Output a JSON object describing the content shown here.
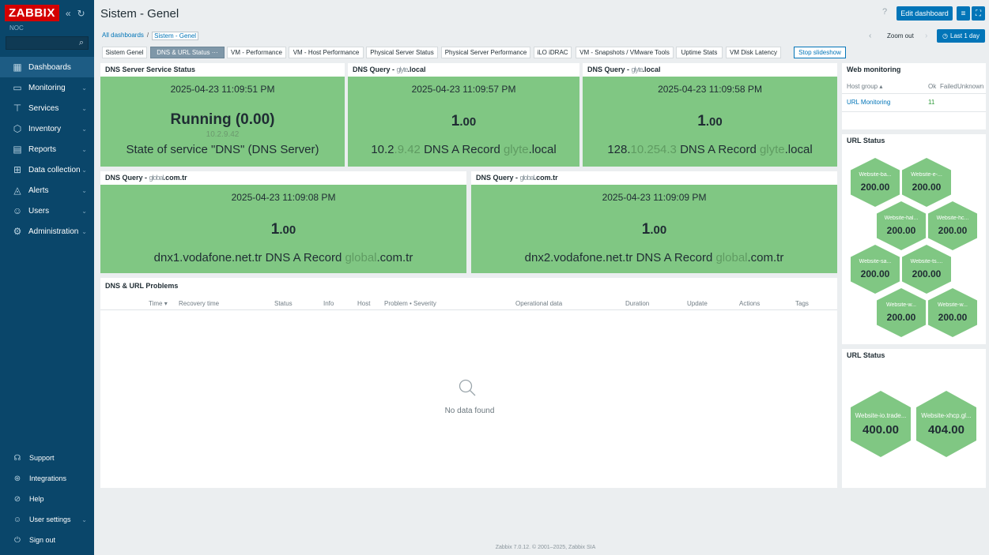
{
  "sidebar": {
    "logo": "ZABBIX",
    "server_name": "NOC",
    "items": [
      {
        "label": "Dashboards",
        "icon": "dashboards-icon"
      },
      {
        "label": "Monitoring",
        "icon": "monitoring-icon"
      },
      {
        "label": "Services",
        "icon": "services-icon"
      },
      {
        "label": "Inventory",
        "icon": "inventory-icon"
      },
      {
        "label": "Reports",
        "icon": "reports-icon"
      },
      {
        "label": "Data collection",
        "icon": "data-collection-icon"
      },
      {
        "label": "Alerts",
        "icon": "alerts-icon"
      },
      {
        "label": "Users",
        "icon": "users-icon"
      },
      {
        "label": "Administration",
        "icon": "administration-icon"
      }
    ],
    "bottom_items": [
      {
        "label": "Support",
        "icon": "support-icon"
      },
      {
        "label": "Integrations",
        "icon": "integrations-icon"
      },
      {
        "label": "Help",
        "icon": "help-icon"
      },
      {
        "label": "User settings",
        "icon": "user-settings-icon"
      },
      {
        "label": "Sign out",
        "icon": "sign-out-icon"
      }
    ]
  },
  "header": {
    "title": "Sistem - Genel",
    "help": "?",
    "edit_label": "Edit dashboard"
  },
  "breadcrumb": {
    "root": "All dashboards",
    "separator": "/",
    "current": "Sistem - Genel"
  },
  "time_controls": {
    "zoom_out": "Zoom out",
    "period": "Last 1 day"
  },
  "tabs": [
    "Sistem Genel",
    "DNS & URL Status",
    "VM - Performance",
    "VM - Host Performance",
    "Physical Server Status",
    "Physical Server Performance",
    "iLO iDRAC",
    "VM - Snapshots / VMware Tools",
    "Uptime Stats",
    "VM Disk Latency"
  ],
  "tab_more": "···",
  "stop_slideshow": "Stop slideshow",
  "widgets": {
    "dns_service": {
      "title": "DNS Server Service Status",
      "time": "2025-04-23 11:09:51 PM",
      "value": "Running (0.00)",
      "host": "10.2.9.42",
      "desc": "State of service \"DNS\" (DNS Server)"
    },
    "dns_q1": {
      "title_prefix": "DNS Query -",
      "title_mask": "glyte",
      "title_suffix": ".local",
      "time": "2025-04-23 11:09:57 PM",
      "value_int": "1",
      "value_dec": ".00",
      "desc_a": "10.2",
      "desc_mask": ".9.42",
      "desc_b": " DNS A Record ",
      "desc_mask2": "glyte",
      "desc_c": ".local"
    },
    "dns_q2": {
      "title_prefix": "DNS Query -",
      "title_mask": "glyte",
      "title_suffix": ".local",
      "time": "2025-04-23 11:09:58 PM",
      "value_int": "1",
      "value_dec": ".00",
      "desc_a": "128.",
      "desc_mask": "10.254.3",
      "desc_b": " DNS A Record ",
      "desc_mask2": "glyte",
      "desc_c": ".local"
    },
    "dns_q3": {
      "title_prefix": "DNS Query -",
      "title_mask": "global",
      "title_suffix": ".com.tr",
      "time": "2025-04-23 11:09:08 PM",
      "value_int": "1",
      "value_dec": ".00",
      "desc_a": "dnx1.vodafone.net.tr DNS A Record ",
      "desc_mask": "global",
      "desc_c": ".com.tr"
    },
    "dns_q4": {
      "title_prefix": "DNS Query -",
      "title_mask": "global",
      "title_suffix": ".com.tr",
      "time": "2025-04-23 11:09:09 PM",
      "value_int": "1",
      "value_dec": ".00",
      "desc_a": "dnx2.vodafone.net.tr DNS A Record ",
      "desc_mask": "global",
      "desc_c": ".com.tr"
    },
    "problems": {
      "title": "DNS & URL Problems",
      "columns": [
        "Time ▾",
        "Recovery time",
        "Status",
        "Info",
        "Host",
        "Problem • Severity",
        "Operational data",
        "Duration",
        "Update",
        "Actions",
        "Tags"
      ],
      "empty": "No data found"
    },
    "web_monitoring": {
      "title": "Web monitoring",
      "columns": [
        "Host group ▴",
        "Ok",
        "Failed",
        "Unknown"
      ],
      "rows": [
        {
          "group": "URL Monitoring",
          "ok": "11"
        }
      ]
    },
    "url_status_1": {
      "title": "URL Status",
      "hexes": [
        {
          "label": "Website-ba...",
          "value": "200.00"
        },
        {
          "label": "Website-e-...",
          "value": "200.00"
        },
        {
          "label": "Website-hal...",
          "value": "200.00"
        },
        {
          "label": "Website-hc...",
          "value": "200.00"
        },
        {
          "label": "Website-sa...",
          "value": "200.00"
        },
        {
          "label": "Website-ts....",
          "value": "200.00"
        },
        {
          "label": "Website-w...",
          "value": "200.00"
        },
        {
          "label": "Website-w...",
          "value": "200.00"
        }
      ]
    },
    "url_status_2": {
      "title": "URL Status",
      "hexes": [
        {
          "label": "Website-io.trade...",
          "value": "400.00"
        },
        {
          "label": "Website-xhcp.gl...",
          "value": "404.00"
        }
      ]
    }
  },
  "colors": {
    "sidebar": "#0a466a",
    "accent": "#0275b8",
    "ok_green": "#80c783",
    "logo_red": "#d40000"
  },
  "footer": "Zabbix 7.0.12. © 2001–2025, Zabbix SIA"
}
